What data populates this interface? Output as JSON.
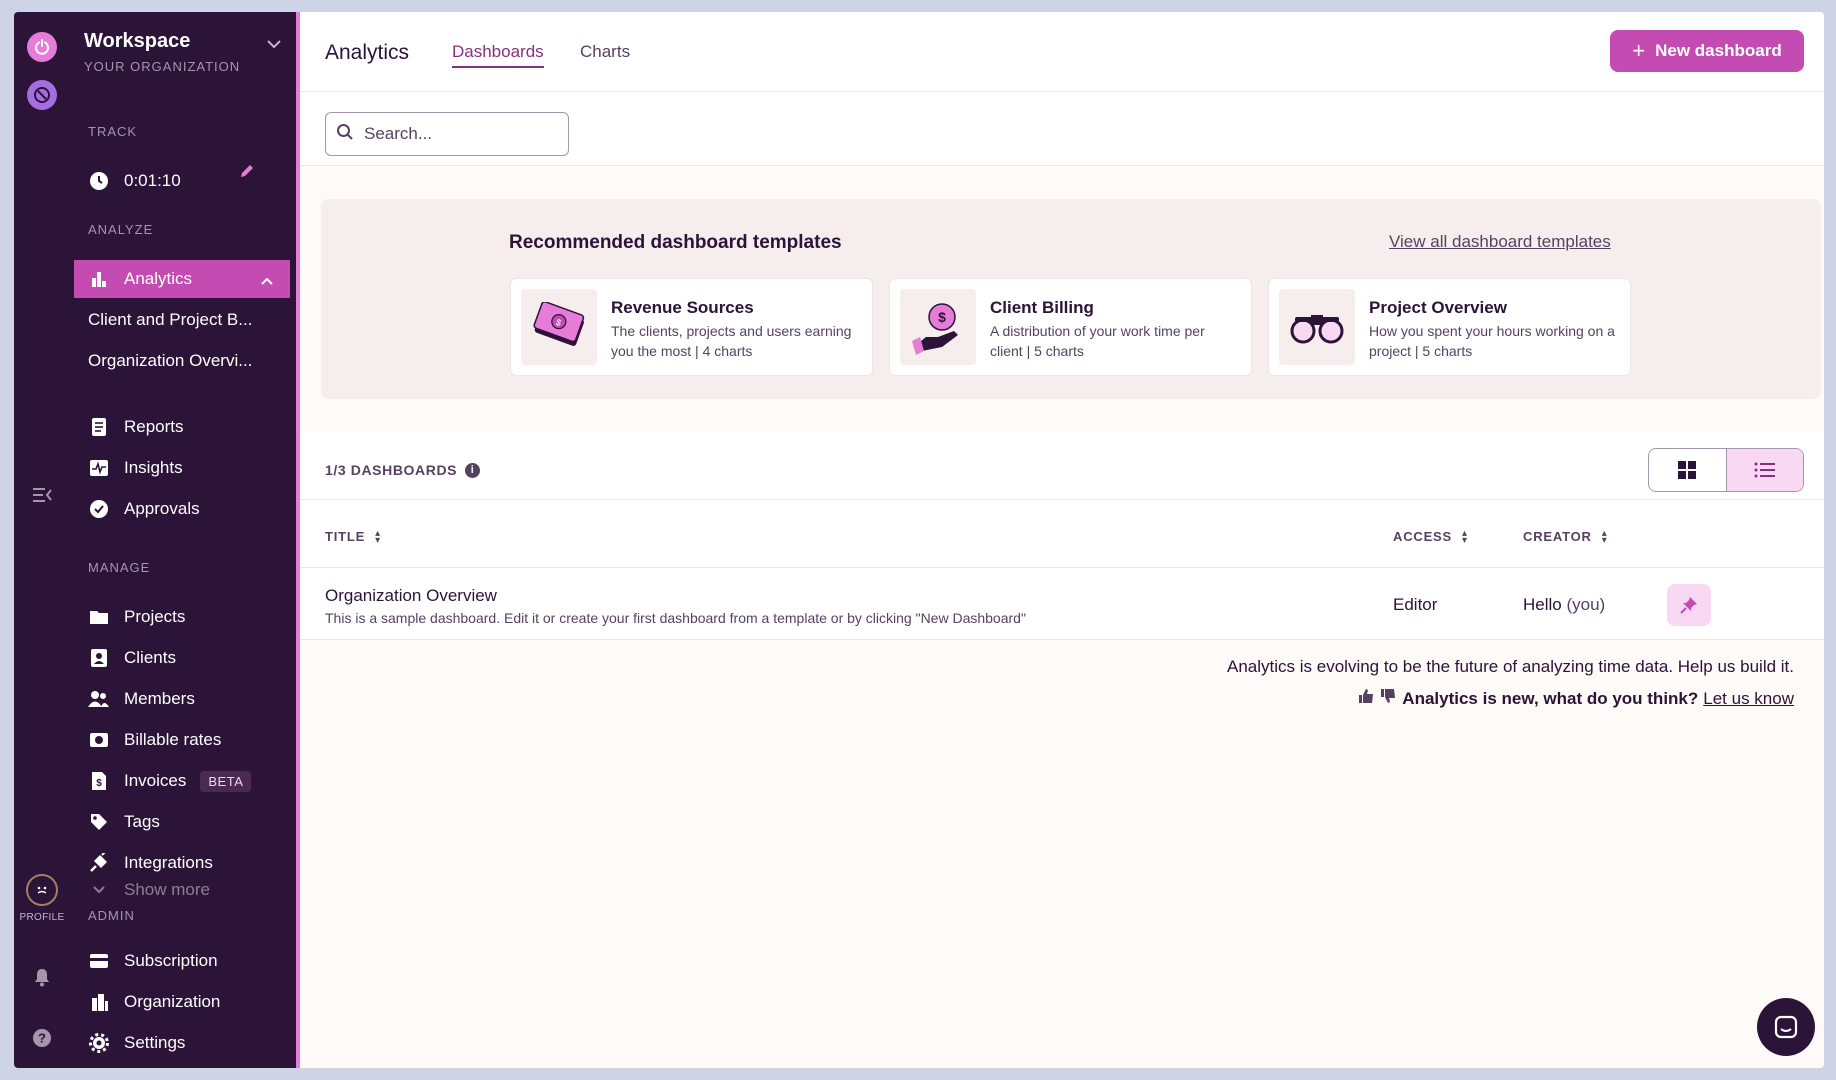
{
  "workspace": {
    "name": "Workspace",
    "subtitle": "YOUR ORGANIZATION"
  },
  "rail": {
    "profile_label": "PROFILE"
  },
  "sidebar": {
    "track_heading": "TRACK",
    "timer": "0:01:10",
    "analyze_heading": "ANALYZE",
    "analytics_label": "Analytics",
    "analytics_children": [
      "Client and Project B...",
      "Organization Overvi..."
    ],
    "analyze_items": [
      "Reports",
      "Insights",
      "Approvals"
    ],
    "manage_heading": "MANAGE",
    "manage_items": [
      "Projects",
      "Clients",
      "Members",
      "Billable rates",
      "Invoices",
      "Tags",
      "Integrations",
      "Show more"
    ],
    "invoices_badge": "BETA",
    "admin_heading": "ADMIN",
    "admin_items": [
      "Subscription",
      "Organization",
      "Settings"
    ]
  },
  "header": {
    "title": "Analytics",
    "tabs": [
      "Dashboards",
      "Charts"
    ],
    "active_tab": "Dashboards",
    "new_button": "New dashboard"
  },
  "search": {
    "placeholder": "Search..."
  },
  "templates": {
    "heading": "Recommended dashboard templates",
    "view_all": "View all dashboard templates",
    "cards": [
      {
        "name": "Revenue Sources",
        "desc": "The clients, projects and users earning you the most | 4 charts",
        "icon": "money-icon"
      },
      {
        "name": "Client Billing",
        "desc": "A distribution of your work time per client | 5 charts",
        "icon": "coin-hand-icon"
      },
      {
        "name": "Project Overview",
        "desc": "How you spent your hours working on a project | 5 charts",
        "icon": "binoculars-icon"
      }
    ]
  },
  "list": {
    "count": "1/3 DASHBOARDS",
    "columns": {
      "title": "TITLE",
      "access": "ACCESS",
      "creator": "CREATOR"
    },
    "rows": [
      {
        "title": "Organization Overview",
        "description": "This is a sample dashboard. Edit it or create your first dashboard from a template or by clicking \"New Dashboard\"",
        "access": "Editor",
        "creator": "Hello",
        "creator_suffix": "(you)"
      }
    ]
  },
  "feedback": {
    "line1": "Analytics is evolving to be the future of analyzing time data. Help us build it.",
    "question": "Analytics is new, what do you think?",
    "link": "Let us know"
  },
  "colors": {
    "sidebar_bg": "#2c1338",
    "accent": "#c44bb2",
    "accent_light": "#f8d8f2",
    "page_bg": "#fefaf7"
  }
}
